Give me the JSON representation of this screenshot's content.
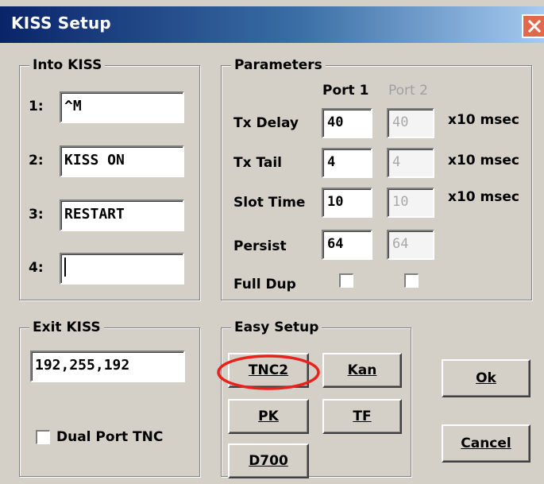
{
  "window": {
    "title": "KISS Setup"
  },
  "into_kiss": {
    "legend": "Into KISS",
    "rows": [
      {
        "label": "1:",
        "value": "^M"
      },
      {
        "label": "2:",
        "value": "KISS ON"
      },
      {
        "label": "3:",
        "value": "RESTART"
      },
      {
        "label": "4:",
        "value": ""
      }
    ]
  },
  "parameters": {
    "legend": "Parameters",
    "port1_header": "Port 1",
    "port2_header": "Port 2",
    "rows": [
      {
        "label": "Tx Delay",
        "port1": "40",
        "port2": "40",
        "unit": "x10 msec"
      },
      {
        "label": "Tx Tail",
        "port1": "4",
        "port2": "4",
        "unit": "x10 msec"
      },
      {
        "label": "Slot Time",
        "port1": "10",
        "port2": "10",
        "unit": "x10 msec"
      },
      {
        "label": "Persist",
        "port1": "64",
        "port2": "64",
        "unit": ""
      }
    ],
    "full_dup_label": "Full Dup",
    "full_dup_port1_checked": false,
    "full_dup_port2_checked": false
  },
  "exit_kiss": {
    "legend": "Exit KISS",
    "value": "192,255,192"
  },
  "dual_port": {
    "label": "Dual Port TNC",
    "checked": false
  },
  "easy_setup": {
    "legend": "Easy Setup",
    "buttons": [
      "TNC2",
      "Kan",
      "PK",
      "TF",
      "D700"
    ],
    "highlighted": "TNC2",
    "highlight_color": "#e8221b"
  },
  "actions": {
    "ok_label": "Ok",
    "cancel_label": "Cancel"
  }
}
